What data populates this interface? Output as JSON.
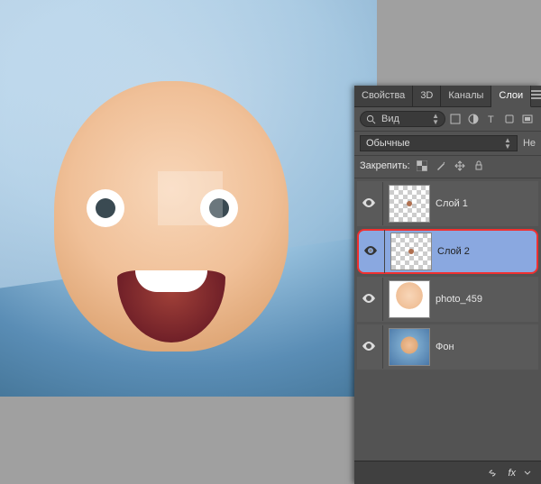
{
  "tabs": {
    "properties": "Свойства",
    "three_d": "3D",
    "channels": "Каналы",
    "layers": "Слои"
  },
  "search": {
    "label": "Вид"
  },
  "blend": {
    "mode": "Обычные",
    "opacity_label": "Не"
  },
  "lock": {
    "label": "Закрепить:"
  },
  "layers": [
    {
      "name": "Слой 1",
      "selected": false,
      "thumb": "checker-dot"
    },
    {
      "name": "Слой 2",
      "selected": true,
      "thumb": "checker-dot"
    },
    {
      "name": "photo_459",
      "selected": false,
      "thumb": "photo"
    },
    {
      "name": "Фон",
      "selected": false,
      "thumb": "photo2"
    }
  ],
  "bottom": {
    "fx": "fx"
  }
}
